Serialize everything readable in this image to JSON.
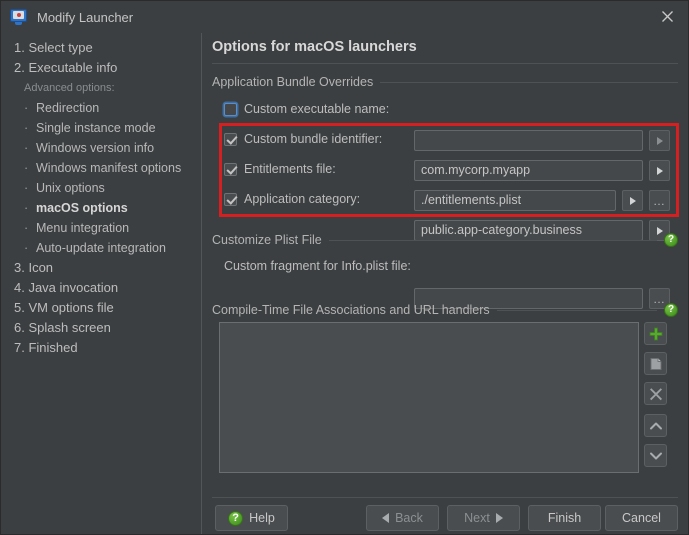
{
  "window": {
    "title": "Modify Launcher",
    "icon": "launcher-monitor-icon",
    "close_label": "×"
  },
  "sidebar": {
    "advanced_caption": "Advanced options:",
    "items": [
      {
        "label": "1. Select type",
        "type": "step"
      },
      {
        "label": "2. Executable info",
        "type": "step"
      },
      {
        "label": "Redirection",
        "type": "sub"
      },
      {
        "label": "Single instance mode",
        "type": "sub"
      },
      {
        "label": "Windows version info",
        "type": "sub"
      },
      {
        "label": "Windows manifest options",
        "type": "sub"
      },
      {
        "label": "Unix options",
        "type": "sub"
      },
      {
        "label": "macOS options",
        "type": "sub",
        "selected": true
      },
      {
        "label": "Menu integration",
        "type": "sub"
      },
      {
        "label": "Auto-update integration",
        "type": "sub"
      },
      {
        "label": "3. Icon",
        "type": "step"
      },
      {
        "label": "4. Java invocation",
        "type": "step"
      },
      {
        "label": "5. VM options file",
        "type": "step"
      },
      {
        "label": "6. Splash screen",
        "type": "step"
      },
      {
        "label": "7. Finished",
        "type": "step"
      }
    ]
  },
  "main": {
    "page_title": "Options for macOS launchers",
    "groups": {
      "bundle_overrides": "Application Bundle Overrides",
      "customize_plist": "Customize Plist File",
      "file_associations": "Compile-Time File Associations and URL handlers"
    },
    "rows": [
      {
        "label": "Custom executable name:",
        "checked": false,
        "focused": true,
        "value": "",
        "arrow_disabled": true,
        "has_browse": false
      },
      {
        "label": "Custom bundle identifier:",
        "checked": true,
        "focused": false,
        "value": "com.mycorp.myapp",
        "arrow_disabled": false,
        "has_browse": false
      },
      {
        "label": "Entitlements file:",
        "checked": true,
        "focused": false,
        "value": "./entitlements.plist",
        "arrow_disabled": false,
        "has_browse": true
      },
      {
        "label": "Application category:",
        "checked": true,
        "focused": false,
        "value": "public.app-category.business",
        "arrow_disabled": false,
        "has_browse": false
      }
    ],
    "plist_fragment": {
      "label": "Custom fragment for Info.plist file:",
      "value": "",
      "browse_label": "..."
    },
    "associations_list": {
      "items": [],
      "toolbar": [
        {
          "name": "add-button",
          "icon": "plus-icon"
        },
        {
          "name": "duplicate-button",
          "icon": "copy-icon"
        },
        {
          "name": "remove-button",
          "icon": "x-icon"
        },
        {
          "name": "move-up-button",
          "icon": "chevron-up-icon"
        },
        {
          "name": "move-down-button",
          "icon": "chevron-down-icon"
        }
      ]
    },
    "help_icon_label": "?"
  },
  "footer": {
    "help": "Help",
    "back": "Back",
    "next": "Next",
    "finish": "Finish",
    "cancel": "Cancel"
  },
  "annotation": {
    "highlight_color": "#d61f20"
  }
}
